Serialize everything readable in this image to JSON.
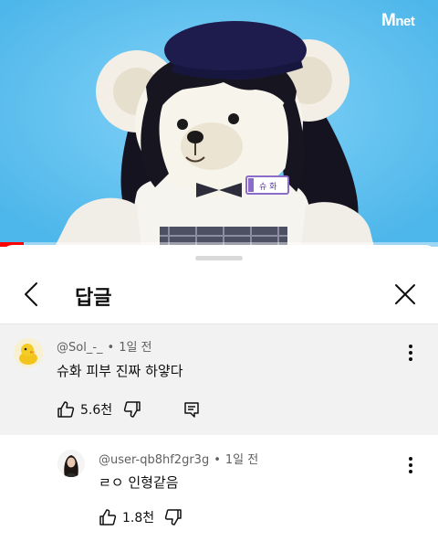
{
  "video": {
    "watermark": "net",
    "watermark_m": "M",
    "progress_fraction": 0.055
  },
  "sheet": {
    "title": "답글"
  },
  "comments": [
    {
      "handle": "@Sol_-_",
      "dot": "•",
      "time": "1일 전",
      "text": "슈화 피부 진짜 하얗다",
      "likes": "5.6천"
    },
    {
      "handle": "@user-qb8hf2gr3g",
      "dot": "•",
      "time": "1일 전",
      "text": "ㄹㅇ 인형같음",
      "likes": "1.8천"
    }
  ],
  "name_tag": "슈 화"
}
